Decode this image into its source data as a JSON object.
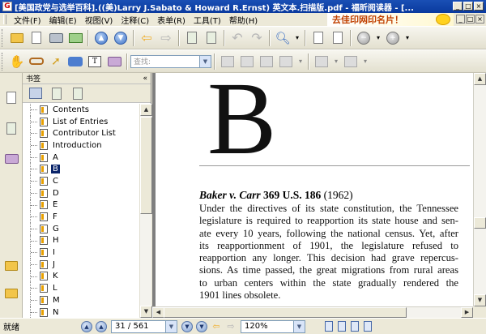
{
  "window": {
    "title": "[美国政党与选举百科].((美)Larry J.Sabato & Howard R.Ernst) 英文本.扫描版.pdf - 福昕阅读器 - [..."
  },
  "menu": {
    "items": [
      "文件(F)",
      "编辑(E)",
      "视图(V)",
      "注释(C)",
      "表单(R)",
      "工具(T)",
      "帮助(H)"
    ],
    "banner": "去佳印网印名片！"
  },
  "toolbar": {
    "ocr_placeholder": "查找:"
  },
  "bookmarks": {
    "header": "书签",
    "items": [
      "Contents",
      "List of Entries",
      "Contributor List",
      "Introduction",
      "A",
      "B",
      "C",
      "D",
      "E",
      "F",
      "G",
      "H",
      "I",
      "J",
      "K",
      "L",
      "M",
      "N"
    ],
    "selected_index": 5
  },
  "document": {
    "big_letter": "B",
    "case_title": "Baker v. Carr",
    "case_citation": "369 U.S. 186",
    "case_year": "(1962)",
    "lines": [
      "Under the directives of its state constitution, the Tennessee",
      "legislature is required to reapportion its state house and sen-",
      "ate every 10 years, following the national census. Yet, after",
      "its reapportionment of 1901, the legislature refused to",
      "reapportion any longer. This decision had grave repercus-",
      "sions. As time passed, the great migrations from rural areas",
      "to urban centers within the state gradually rendered the",
      "1901 lines obsolete."
    ]
  },
  "status": {
    "text": "就绪",
    "page": "31 / 561",
    "zoom": "120%"
  }
}
